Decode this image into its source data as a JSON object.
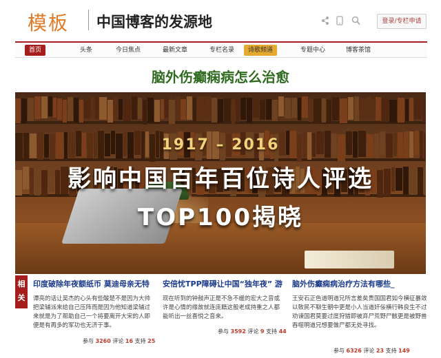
{
  "header": {
    "logo": "模板",
    "tagline": "中国博客的发源地",
    "login_label": "登录/专栏申请"
  },
  "icons": [
    "share-icon",
    "mobile-icon",
    "search-icon"
  ],
  "nav": [
    {
      "label": "首页",
      "state": "active"
    },
    {
      "label": "头条",
      "state": "normal"
    },
    {
      "label": "今日焦点",
      "state": "normal"
    },
    {
      "label": "最新文章",
      "state": "normal"
    },
    {
      "label": "专栏名录",
      "state": "normal"
    },
    {
      "label": "诗歌频道",
      "state": "highlight"
    },
    {
      "label": "专题中心",
      "state": "normal"
    },
    {
      "label": "博客茶馆",
      "state": "normal"
    }
  ],
  "page_title": "脑外伤癫痫病怎么治愈",
  "banner": {
    "years": "1917 – 2016",
    "line1": "影响中国百年百位诗人评选",
    "line2": "TOP100揭晓"
  },
  "related": {
    "tag_char1": "相",
    "tag_char2": "关",
    "articles": [
      {
        "title": "印度破除年夜额纸币 莫迪母亲无特",
        "body": "谭亮的话让吴杰的心头有些酸楚不是因为大帅把梁辅派来给自己压阵而是因为他知道梁辅过来就是为了帮助自己一个将要离开大宋的人即便是有再多的军功也无济于事。",
        "views_label": "参与",
        "views": "3260",
        "comments_label": "评论",
        "comments": "16",
        "likes_label": "支持",
        "likes": "25"
      },
      {
        "title": "安倍忧TPP障碍让中国“独年夜” 游",
        "body": "现在听到的钟鼓声正是不急不缓的宏大之音或许是心情的缘故就连庞籍这般老成持重之人都能听出一丝喜悦之音来。",
        "views_label": "参与",
        "views": "3592",
        "comments_label": "评论",
        "comments": "9",
        "likes_label": "支持",
        "likes": "44"
      },
      {
        "title": "脑外伤癫痫病治疗方法有哪些_",
        "body": "王安石正色道明道兄所言差矣贵国国君如今横征暴敛以致民不聊生朝中更是小人当道奸佞横行韩良生不过劝谏国君莫要过度狩猎即被弃尸荒野尸骸更是被野兽吞噬明道兄想要做尸都无处寻找。",
        "views_label": "参与",
        "views": "6326",
        "comments_label": "评论",
        "comments": "23",
        "likes_label": "支持",
        "likes": "149"
      }
    ]
  },
  "colors": {
    "brand_red": "#a51d1d",
    "logo_orange": "#e07a26",
    "title_green": "#2f6b1f",
    "link_blue": "#1a3a8a",
    "highlight_gold": "#e6a92f"
  }
}
